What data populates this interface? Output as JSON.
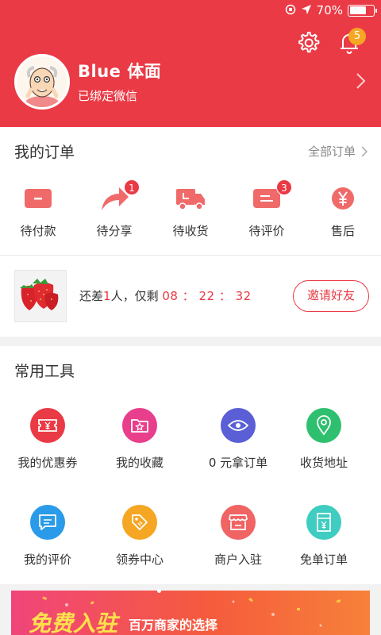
{
  "status_bar": {
    "battery_text": "70%",
    "battery_level": 0.7
  },
  "header": {
    "username": "Blue 体面",
    "wechat_status": "已绑定微信",
    "notification_count": "5"
  },
  "orders": {
    "title": "我的订单",
    "all_orders_label": "全部订单",
    "tabs": [
      {
        "label": "待付款",
        "badge": "",
        "icon": "wallet-icon"
      },
      {
        "label": "待分享",
        "badge": "1",
        "icon": "share-icon"
      },
      {
        "label": "待收货",
        "badge": "",
        "icon": "truck-icon"
      },
      {
        "label": "待评价",
        "badge": "3",
        "icon": "comment-icon"
      },
      {
        "label": "售后",
        "badge": "",
        "icon": "yuan-icon"
      }
    ]
  },
  "group_buy": {
    "prefix": "还差",
    "count": "1",
    "middle": "人，仅剩",
    "timer": "08 ： 22 ： 32",
    "invite_label": "邀请好友"
  },
  "tools": {
    "title": "常用工具",
    "items": [
      {
        "label": "我的优惠券",
        "icon": "coupon-icon",
        "color": "#ea3a45"
      },
      {
        "label": "我的收藏",
        "icon": "star-folder-icon",
        "color": "#e83e8c"
      },
      {
        "label": "0 元拿订单",
        "icon": "eye-icon",
        "color": "#5a5fd6"
      },
      {
        "label": "收货地址",
        "icon": "location-pin-icon",
        "color": "#2ec06e"
      },
      {
        "label": "我的评价",
        "icon": "message-icon",
        "color": "#2a9be8"
      },
      {
        "label": "领券中心",
        "icon": "tag-icon",
        "color": "#f5a623"
      },
      {
        "label": "商户入驻",
        "icon": "store-icon",
        "color": "#f06464"
      },
      {
        "label": "免单订单",
        "icon": "free-order-icon",
        "color": "#3ecdc0"
      }
    ]
  },
  "banner": {
    "title": "免费入驻",
    "subtitle": "百万商家的选择"
  },
  "colors": {
    "brand_red": "#ea3a45",
    "badge_orange": "#f5a623"
  }
}
